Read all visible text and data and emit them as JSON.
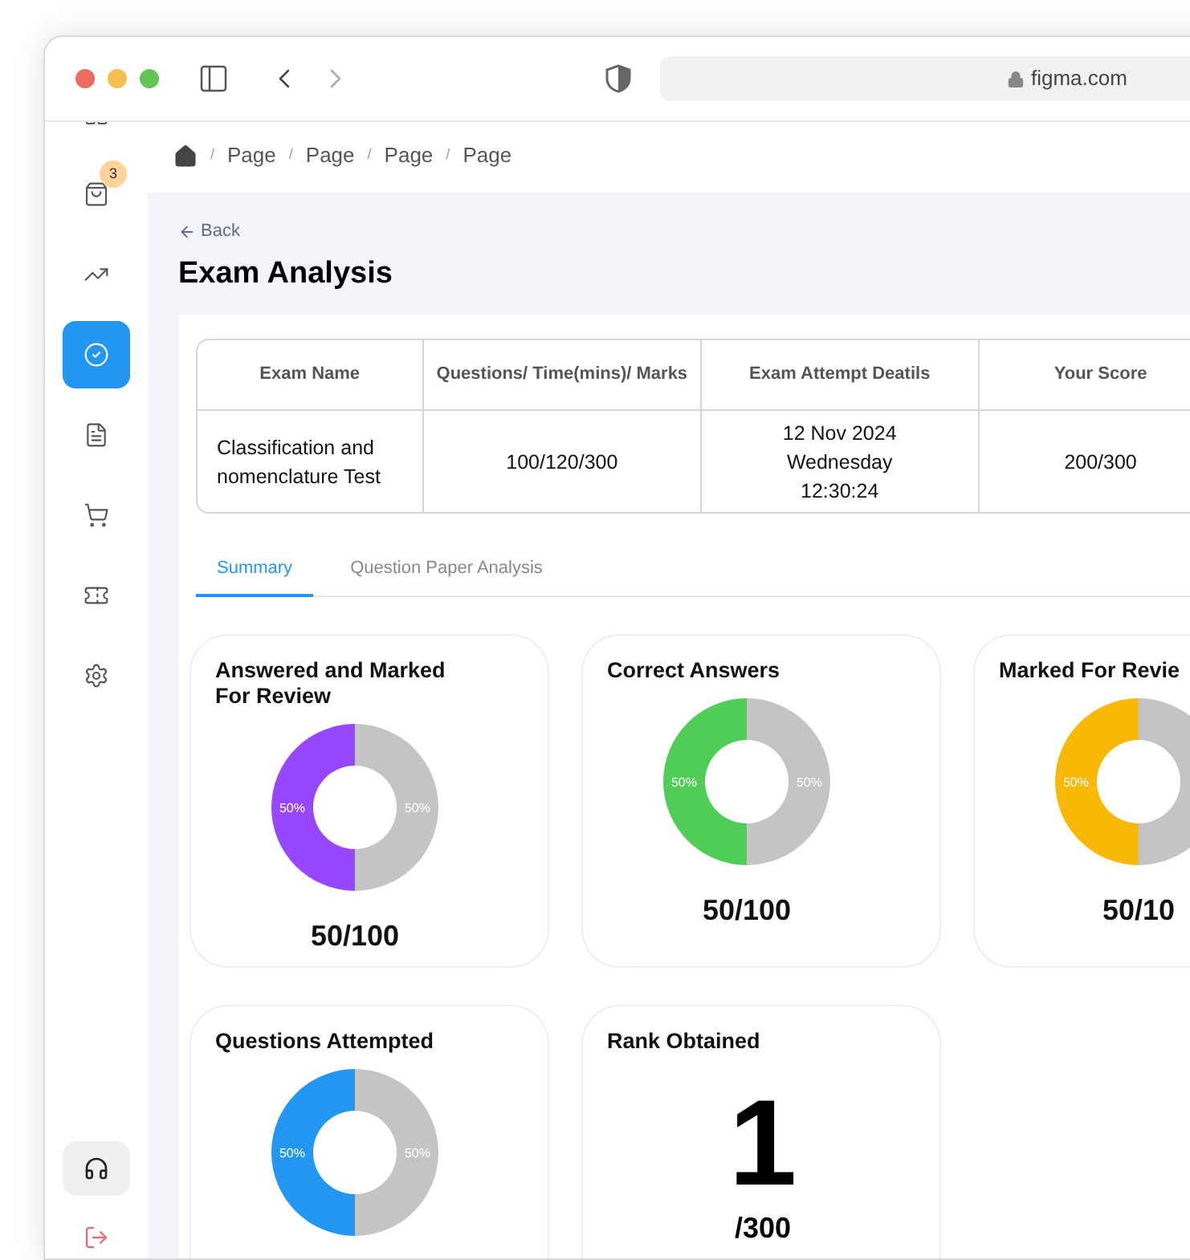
{
  "browser": {
    "url": "figma.com"
  },
  "sidebar": {
    "items": [
      {
        "selected": false
      },
      {
        "selected": false,
        "badge": "3"
      },
      {
        "selected": false
      },
      {
        "selected": true
      },
      {
        "selected": false
      },
      {
        "selected": false
      },
      {
        "selected": false
      },
      {
        "selected": false
      }
    ]
  },
  "breadcrumb": {
    "separators": [
      "/",
      "/",
      "/",
      "/"
    ],
    "items": [
      "Page",
      "Page",
      "Page",
      "Page"
    ]
  },
  "header": {
    "back": "Back",
    "title": "Exam Analysis"
  },
  "table": {
    "columns": [
      "Exam Name",
      "Questions/ Time(mins)/ Marks",
      "Exam Attempt Deatils",
      "Your Score"
    ],
    "rows": [
      [
        "Classification and nomenclature Test",
        "100/120/300",
        "12 Nov 2024\nWednesday\n12:30:24",
        "200/300"
      ]
    ]
  },
  "tabs": [
    {
      "label": "Summary",
      "selected": true
    },
    {
      "label": "Question Paper Analysis",
      "selected": false
    }
  ],
  "cards": [
    {
      "kind": "donut",
      "title": "Answered and Marked For Review",
      "score": "50/100",
      "chart_data": {
        "type": "donut",
        "values": [
          50,
          50
        ],
        "value_labels": [
          "50%",
          "50%"
        ],
        "colors": [
          "#9747ff",
          "#c4c4c4"
        ]
      }
    },
    {
      "kind": "donut",
      "title": "Correct Answers",
      "score": "50/100",
      "chart_data": {
        "type": "donut",
        "values": [
          50,
          50
        ],
        "value_labels": [
          "50%",
          "50%"
        ],
        "colors": [
          "#4fcd57",
          "#c4c4c4"
        ]
      }
    },
    {
      "kind": "donut",
      "title": "Marked For Revie",
      "score": "50/10",
      "chart_data": {
        "type": "donut",
        "values": [
          50,
          50
        ],
        "value_labels": [
          "50%",
          null
        ],
        "colors": [
          "#f8b805",
          "#c4c4c4"
        ]
      }
    },
    {
      "kind": "donut",
      "title": "Questions Attempted",
      "chart_data": {
        "type": "donut",
        "values": [
          50,
          50
        ],
        "value_labels": [
          "50%",
          "50%"
        ],
        "colors": [
          "#2196f3",
          "#c4c4c4"
        ]
      }
    },
    {
      "kind": "rank",
      "title": "Rank Obtained",
      "value": "1",
      "total": "/300"
    }
  ]
}
